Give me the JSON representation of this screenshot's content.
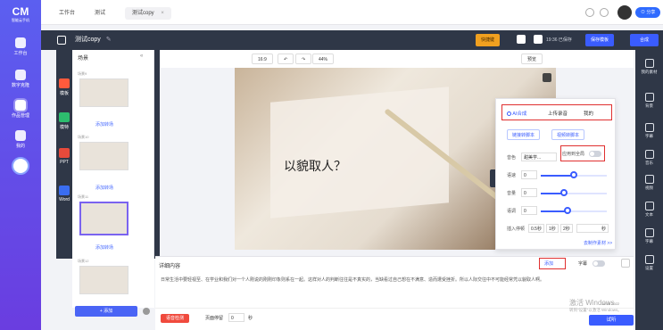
{
  "app": {
    "logo_mark": "CM",
    "logo_sub": "智能云手机"
  },
  "rail": [
    {
      "label": "工作台"
    },
    {
      "label": "数字克隆"
    },
    {
      "label": "作品管理"
    },
    {
      "label": "我的"
    }
  ],
  "tabs": [
    {
      "label": "工作台"
    },
    {
      "label": "测试"
    },
    {
      "label": "测试copy",
      "close": "×"
    }
  ],
  "topbar": {
    "share": "⊙ 分享"
  },
  "project": {
    "title": "测试copy",
    "edit_icon": "pencil",
    "shortcut": "快捷键",
    "save_status": "19:36 已保存",
    "save_template": "保存模板",
    "compose": "合成"
  },
  "tools": [
    {
      "label": "模板",
      "color": "#ff5a3c"
    },
    {
      "label": "模特",
      "color": "#2dbd6e"
    },
    {
      "label": "PPT",
      "color": "#e64a3b"
    },
    {
      "label": "Word",
      "color": "#3a6df0"
    }
  ],
  "scenes": {
    "header": "场景",
    "items": [
      {
        "label": "场景9",
        "add": "添加转场"
      },
      {
        "label": "场景10",
        "add": "添加转场"
      },
      {
        "label": "场景11",
        "add": "添加转场"
      },
      {
        "label": "场景12",
        "add": ""
      }
    ],
    "add_button": "+ 添加"
  },
  "canvas_bar": {
    "ratio": "16:9",
    "zoom": "44%",
    "preview": "预览"
  },
  "slide": {
    "text": "以貌取人？"
  },
  "tts": {
    "tabs": [
      "AI合成",
      "上传录音",
      "我的"
    ],
    "buttons": [
      "链接转脚本",
      "视频转脚本"
    ],
    "voice_label": "音色",
    "voice_value": "甜美学...",
    "apply_all": "应用到全局",
    "speed_label": "语速",
    "speed_value": "0",
    "speed_level": 0.5,
    "volume_label": "音量",
    "volume_value": "0",
    "volume_level": 0.35,
    "pitch_label": "语调",
    "pitch_value": "0",
    "pitch_level": 0.4,
    "pause_label": "插入停顿",
    "pause_opts": [
      "0.5秒",
      "1秒",
      "2秒"
    ],
    "pause_unit": "秒",
    "more": "去制作素材 >>"
  },
  "right_rail": [
    "我的素材",
    "背景",
    "字幕",
    "音乐",
    "视频",
    "文本",
    "字幕",
    "设置"
  ],
  "detail": {
    "title": "详细内容",
    "add": "添加",
    "subtitle": "字幕",
    "text": "日常生活中要轻视至、在学业和我们对一个人刚说的刚刚印象则系在一起。这样对人的判断往往是不真实的，当缺看过自己想在不满意、造而遭受挫折。所以人际交往中不可能经常凭以貌取人啊。"
  },
  "footer": {
    "record": "语音检测",
    "page_label": "页面停留",
    "page_value": "0",
    "page_unit": "秒",
    "try": "试听",
    "watermark1": "激活 Windows",
    "watermark2": "转到\"设置\"以激活 Windows。",
    "time": "18:36 2022"
  }
}
